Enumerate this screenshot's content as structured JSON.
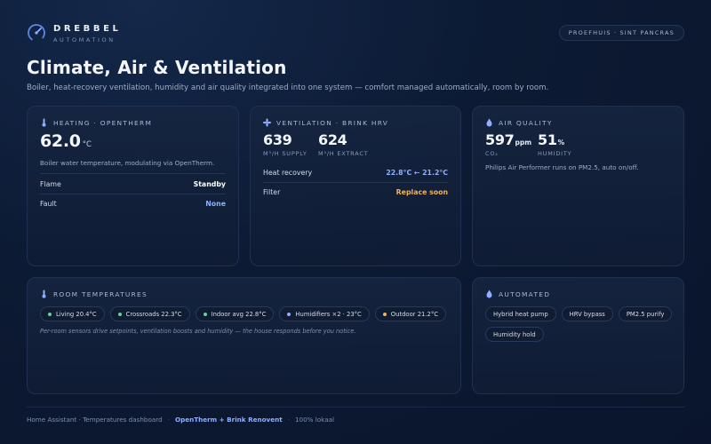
{
  "brand": {
    "name": "DREBBEL",
    "sub": "AUTOMATION"
  },
  "location": "PROEFHUIS · SINT PANCRAS",
  "page": {
    "title": "Climate, Air & Ventilation",
    "subtitle": "Boiler, heat-recovery ventilation, humidity and air quality integrated into one system — comfort managed automatically, room by room."
  },
  "heating": {
    "label": "HEATING · OPENTHERM",
    "value": "62.0",
    "unit": "°C",
    "description": "Boiler water temperature, modulating via OpenTherm.",
    "rows": [
      {
        "key": "Flame",
        "value": "Standby"
      },
      {
        "key": "Fault",
        "value": "None"
      }
    ]
  },
  "ventilation": {
    "label": "VENTILATION · BRINK HRV",
    "supply_value": "639",
    "supply_label": "M³/H SUPPLY",
    "extract_value": "624",
    "extract_label": "M³/H EXTRACT",
    "rows": [
      {
        "key": "Heat recovery",
        "value": "22.8°C ← 21.2°C"
      },
      {
        "key": "Filter",
        "value": "Replace soon"
      }
    ]
  },
  "air_quality": {
    "label": "AIR QUALITY",
    "co2_value": "597",
    "co2_unit": "ppm",
    "co2_label": "CO₂",
    "humidity_value": "51",
    "humidity_unit": "%",
    "humidity_label": "HUMIDITY",
    "description": "Philips Air Performer runs on PM2.5, auto on/off."
  },
  "rooms": {
    "label": "ROOM TEMPERATURES",
    "chips": [
      {
        "text": "Living 20.4°C",
        "color": "#5fd3a8"
      },
      {
        "text": "Crossroads 22.3°C",
        "color": "#5fd3a8"
      },
      {
        "text": "Indoor avg 22.8°C",
        "color": "#5fd3a8"
      },
      {
        "text": "Humidifiers ×2 · 23°C",
        "color": "#8fb0ff"
      },
      {
        "text": "Outdoor 21.2°C",
        "color": "#f0b35a"
      }
    ],
    "note": "Per-room sensors drive setpoints, ventilation boosts and humidity — the house responds before you notice."
  },
  "automated": {
    "label": "AUTOMATED",
    "chips": [
      "Hybrid heat pump",
      "HRV bypass",
      "PM2.5 purify",
      "Humidity hold"
    ]
  },
  "footer": {
    "source": "Home Assistant · Temperatures dashboard",
    "highlight": "OpenTherm + Brink Renovent",
    "local": "100% lokaal"
  },
  "colors": {
    "accent": "#8fb0ff",
    "standby": "#ffffff",
    "none": "#8fb0ff",
    "warning": "#f0b35a"
  }
}
